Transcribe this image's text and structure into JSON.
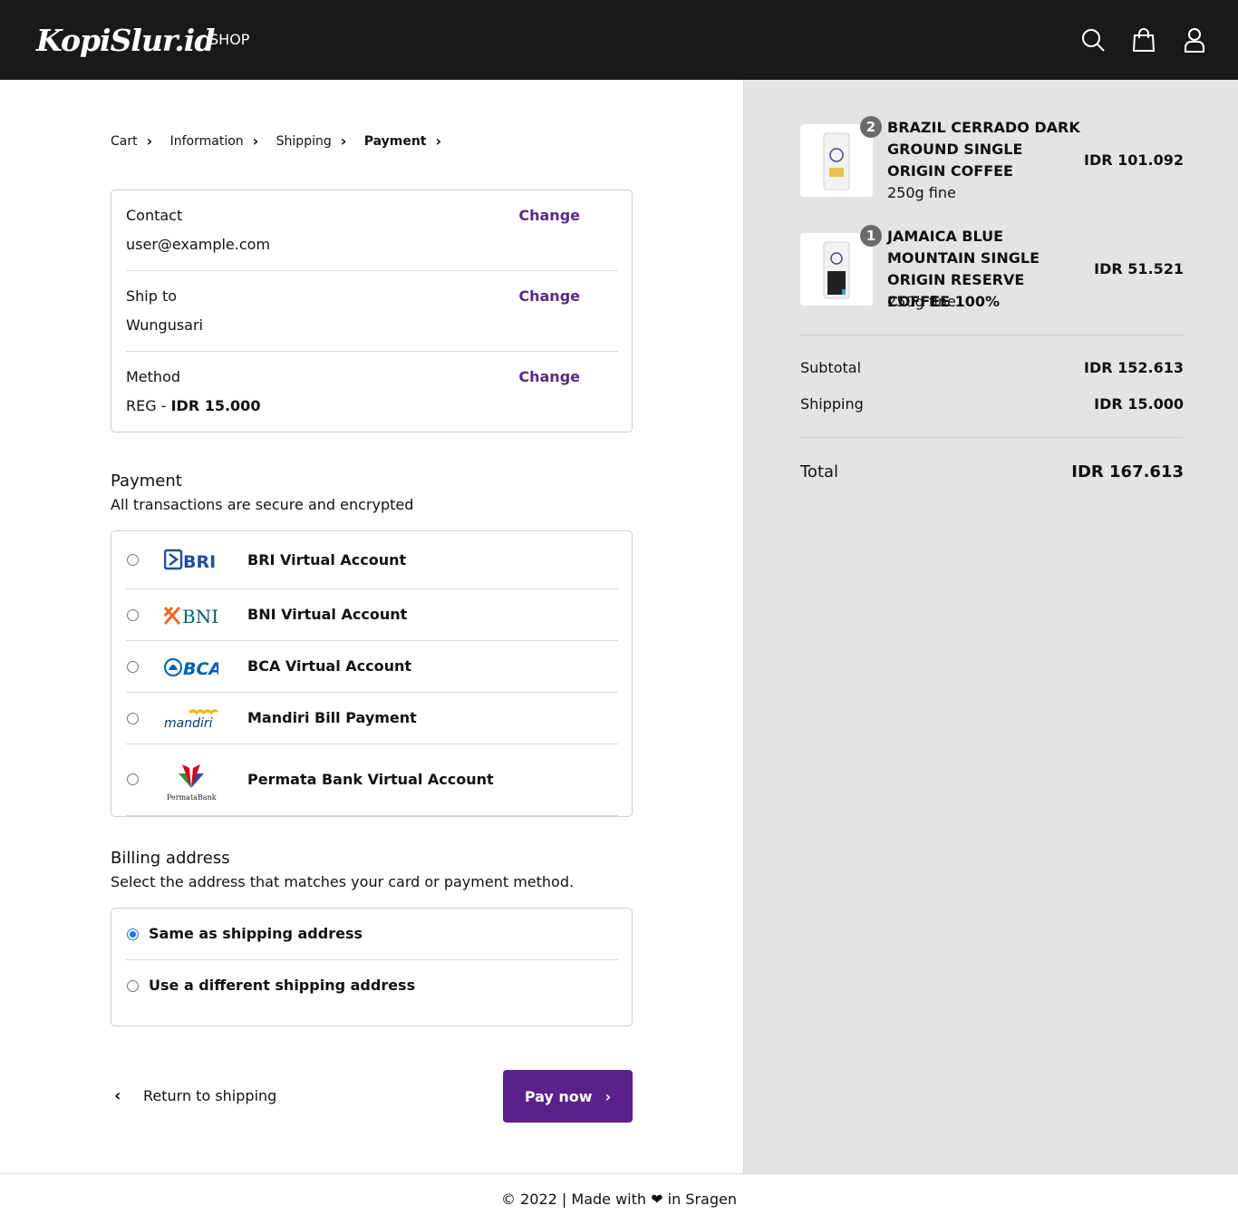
{
  "header": {
    "logo": "KopiSlur.id",
    "nav_shop": "SHOP",
    "icons": [
      "search-icon",
      "cart-icon",
      "user-icon"
    ]
  },
  "breadcrumb": [
    "Cart",
    "Information",
    "Shipping",
    "Payment"
  ],
  "review": {
    "contact_label": "Contact",
    "contact_value": "user@example.com",
    "ship_label": "Ship to",
    "ship_value": "Wungusari",
    "method_label": "Method",
    "method_prefix": "REG - ",
    "method_price": "IDR 15.000",
    "change_label": "Change"
  },
  "payment": {
    "title": "Payment",
    "subtitle": "All transactions are secure and encrypted",
    "options": [
      {
        "name": "BRI Virtual Account",
        "logo": "BRI"
      },
      {
        "name": "BNI Virtual Account",
        "logo": "BNI"
      },
      {
        "name": "BCA Virtual Account",
        "logo": "BCA"
      },
      {
        "name": "Mandiri Bill Payment",
        "logo": "mandiri"
      },
      {
        "name": "Permata Bank Virtual Account",
        "logo": "PermataBank"
      }
    ]
  },
  "billing": {
    "title": "Billing address",
    "subtitle": "Select the address that matches your card or payment method.",
    "options": [
      "Same as shipping address",
      "Use a different shipping address"
    ],
    "selected": 0
  },
  "actions": {
    "return_label": "Return to shipping",
    "pay_label": "Pay now"
  },
  "cart": {
    "items": [
      {
        "qty": "2",
        "name": "BRAZIL CERRADO DARK GROUND SINGLE ORIGIN COFFEE",
        "variant": "250g fine",
        "price": "IDR 101.092"
      },
      {
        "qty": "1",
        "name": "JAMAICA BLUE MOUNTAIN SINGLE ORIGIN RESERVE COFFEE 100%",
        "variant": "250g fine",
        "price": "IDR 51.521"
      }
    ],
    "subtotal_label": "Subtotal",
    "subtotal": "IDR 152.613",
    "shipping_label": "Shipping",
    "shipping": "IDR 15.000",
    "total_label": "Total",
    "total": "IDR 167.613"
  },
  "footer": {
    "text": "© 2022 | Made with ❤ in Sragen"
  },
  "colors": {
    "header_bg": "#191919",
    "accent": "#5a2189",
    "summary_bg": "#e4e4e4"
  }
}
